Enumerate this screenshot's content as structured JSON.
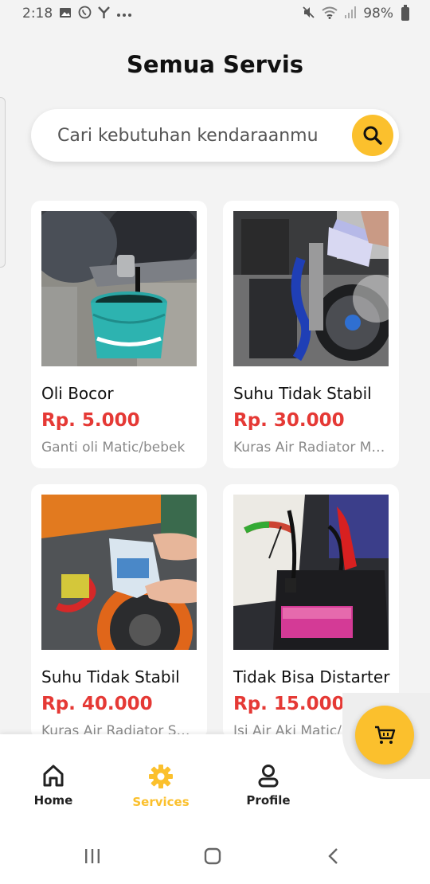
{
  "status_bar": {
    "time": "2:18",
    "battery": "98%"
  },
  "page": {
    "title": "Semua Servis"
  },
  "search": {
    "placeholder": "Cari kebutuhan kendaraanmu"
  },
  "services": [
    {
      "title": "Oli Bocor",
      "price": "Rp. 5.000",
      "description": "Ganti oli Matic/bebek"
    },
    {
      "title": "Suhu Tidak Stabil",
      "price": "Rp. 30.000",
      "description": "Kuras Air Radiator Matic"
    },
    {
      "title": "Suhu Tidak Stabil",
      "price": "Rp. 40.000",
      "description": "Kuras Air Radiator Sport"
    },
    {
      "title": "Tidak Bisa Distarter",
      "price": "Rp. 15.000",
      "description": "Isi Air Aki Matic/Bebek"
    }
  ],
  "bottom_nav": {
    "items": [
      {
        "label": "Home",
        "icon": "home-icon"
      },
      {
        "label": "Services",
        "icon": "gear-icon",
        "active": true
      },
      {
        "label": "Profile",
        "icon": "user-icon"
      }
    ]
  },
  "colors": {
    "accent": "#fbc02d",
    "price": "#e53935",
    "background": "#f3f3f3"
  }
}
